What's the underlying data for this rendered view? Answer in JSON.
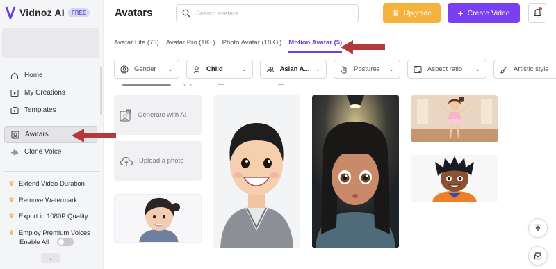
{
  "app": {
    "name": "Vidnoz AI",
    "badge": "FREE"
  },
  "header": {
    "title": "Avatars",
    "search_placeholder": "Search avatars",
    "upgrade_label": "Upgrade",
    "create_label": "Create Video"
  },
  "sidebar": {
    "items": [
      {
        "label": "Home",
        "icon": "home-icon"
      },
      {
        "label": "My Creations",
        "icon": "play-icon"
      },
      {
        "label": "Templates",
        "icon": "templates-icon"
      },
      {
        "label": "Avatars",
        "icon": "avatar-icon",
        "active": true
      },
      {
        "label": "Clone Voice",
        "icon": "voice-icon"
      }
    ],
    "perks": [
      "Extend Video Duration",
      "Remove Watermark",
      "Export in 1080P Quality",
      "Employ Premium Voices"
    ],
    "enable_all_label": "Enable All"
  },
  "tabs": [
    {
      "label": "Avatar Lite (73)"
    },
    {
      "label": "Avatar Pro (1K+)"
    },
    {
      "label": "Photo Avatar (18K+)"
    },
    {
      "label": "Motion Avatar (5)",
      "active": true
    }
  ],
  "filters": [
    {
      "label": "Gender"
    },
    {
      "label": "Child"
    },
    {
      "label": "Asian A..."
    },
    {
      "label": "Postures"
    },
    {
      "label": "Aspect ratio"
    },
    {
      "label": "Artistic style"
    }
  ],
  "tools": {
    "generate_label": "Generate with AI",
    "upload_label": "Upload a photo"
  },
  "colors": {
    "accent": "#6b3fe0",
    "upgrade": "#f5b23c",
    "create": "#7b3ff2",
    "arrow": "#b33a3a"
  }
}
